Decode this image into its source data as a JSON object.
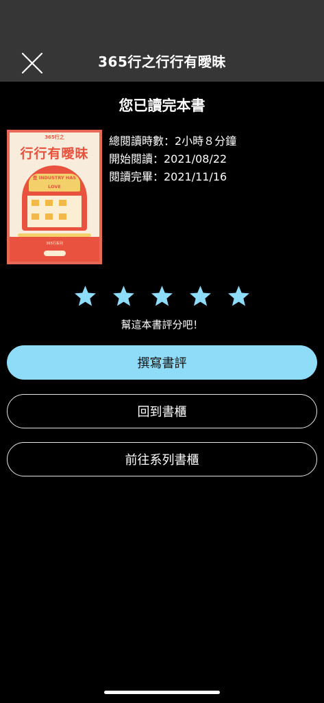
{
  "nav": {
    "title": "365行之行行有曖昧",
    "close_icon": "close-icon"
  },
  "completion": {
    "heading": "您已讀完本書"
  },
  "book": {
    "cover_title": "行行有曖昧",
    "cover_top": "365行之",
    "cover_arch_label": "是 INDUSTRY HAS LOVE",
    "cover_strip_text": "365行系列"
  },
  "stats": {
    "total_time": "總閱讀時數：2小時８分鐘",
    "start_date": "開始閱讀：2021/08/22",
    "end_date": "閱讀完畢：2021/11/16"
  },
  "rating": {
    "stars": 5,
    "star_icon": "star-icon",
    "star_color": "#8fdcf9",
    "hint": "幫這本書評分吧！"
  },
  "actions": {
    "write_review": "撰寫書評",
    "back_to_shelf": "回到書櫃",
    "go_series_shelf": "前往系列書櫃"
  },
  "colors": {
    "accent": "#8fdcf9",
    "nav_bg": "#363636",
    "background": "#000000",
    "cover_red": "#e8523e"
  }
}
